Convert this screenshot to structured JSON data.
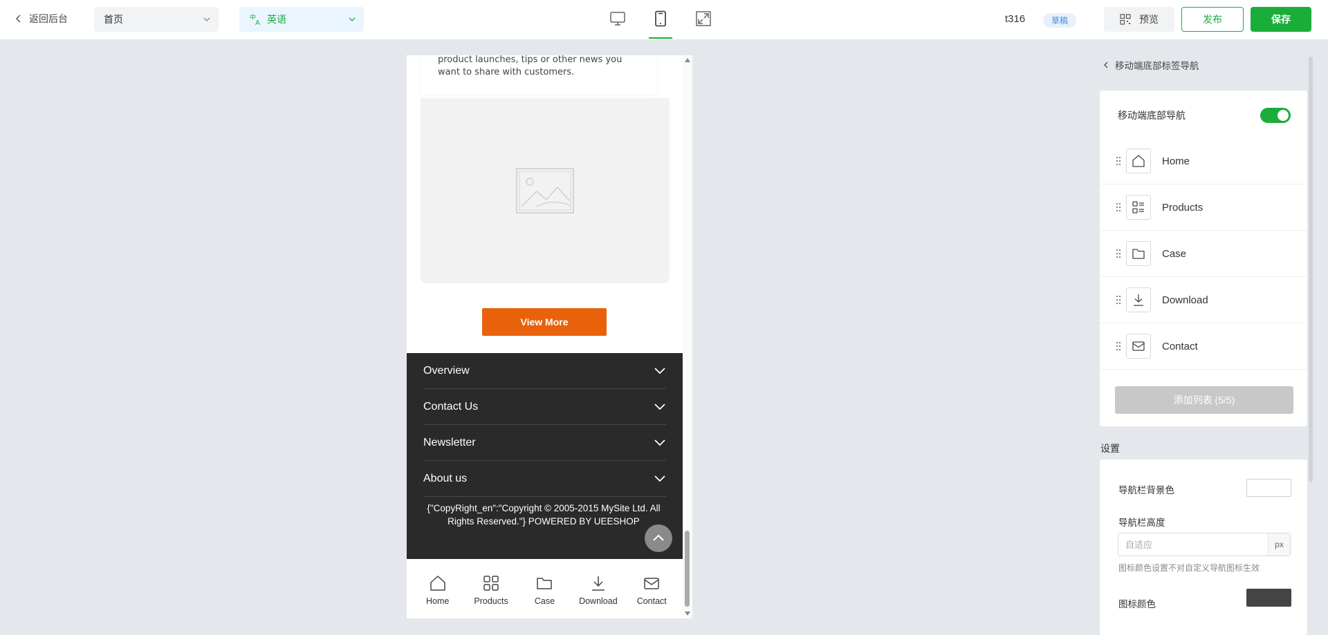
{
  "topbar": {
    "back_label": "返回后台",
    "page_select": "首页",
    "language_select": "英语",
    "site_name": "t316",
    "status_badge": "草稿",
    "preview_label": "预览",
    "publish_label": "发布",
    "save_label": "保存",
    "active_device": "mobile"
  },
  "preview": {
    "news_text": "product launches, tips or other news you want to share with customers.",
    "view_more": "View More",
    "footer_sections": [
      "Overview",
      "Contact Us",
      "Newsletter",
      "About us"
    ],
    "copyright": "{\"CopyRight_en\":\"Copyright © 2005-2015 MySite Ltd. All Rights Reserved.\"} POWERED BY UEESHOP",
    "bottom_nav": [
      {
        "label": "Home",
        "icon": "home-icon"
      },
      {
        "label": "Products",
        "icon": "grid-icon"
      },
      {
        "label": "Case",
        "icon": "folder-icon"
      },
      {
        "label": "Download",
        "icon": "download-icon"
      },
      {
        "label": "Contact",
        "icon": "mail-icon"
      }
    ],
    "accent_color": "#e8620b",
    "footer_bg": "#2a2a2a"
  },
  "panel": {
    "back_label": "移动端底部标签导航",
    "toggle_label": "移动端底部导航",
    "toggle_on": true,
    "nav_items": [
      {
        "label": "Home",
        "icon": "home-icon"
      },
      {
        "label": "Products",
        "icon": "list-icon"
      },
      {
        "label": "Case",
        "icon": "folder-icon"
      },
      {
        "label": "Download",
        "icon": "download-icon"
      },
      {
        "label": "Contact",
        "icon": "mail-icon"
      }
    ],
    "add_list_label": "添加列表 (5/5)",
    "settings_title": "设置",
    "bg_color_label": "导航栏背景色",
    "bg_color_value": "#ffffff",
    "height_label": "导航栏高度",
    "height_placeholder": "自适应",
    "height_unit": "px",
    "height_hint": "图标颜色设置不对自定义导航图标生效",
    "icon_color_label": "图标颜色",
    "icon_color_value": "#444444",
    "brand_color": "#1aad3a"
  }
}
